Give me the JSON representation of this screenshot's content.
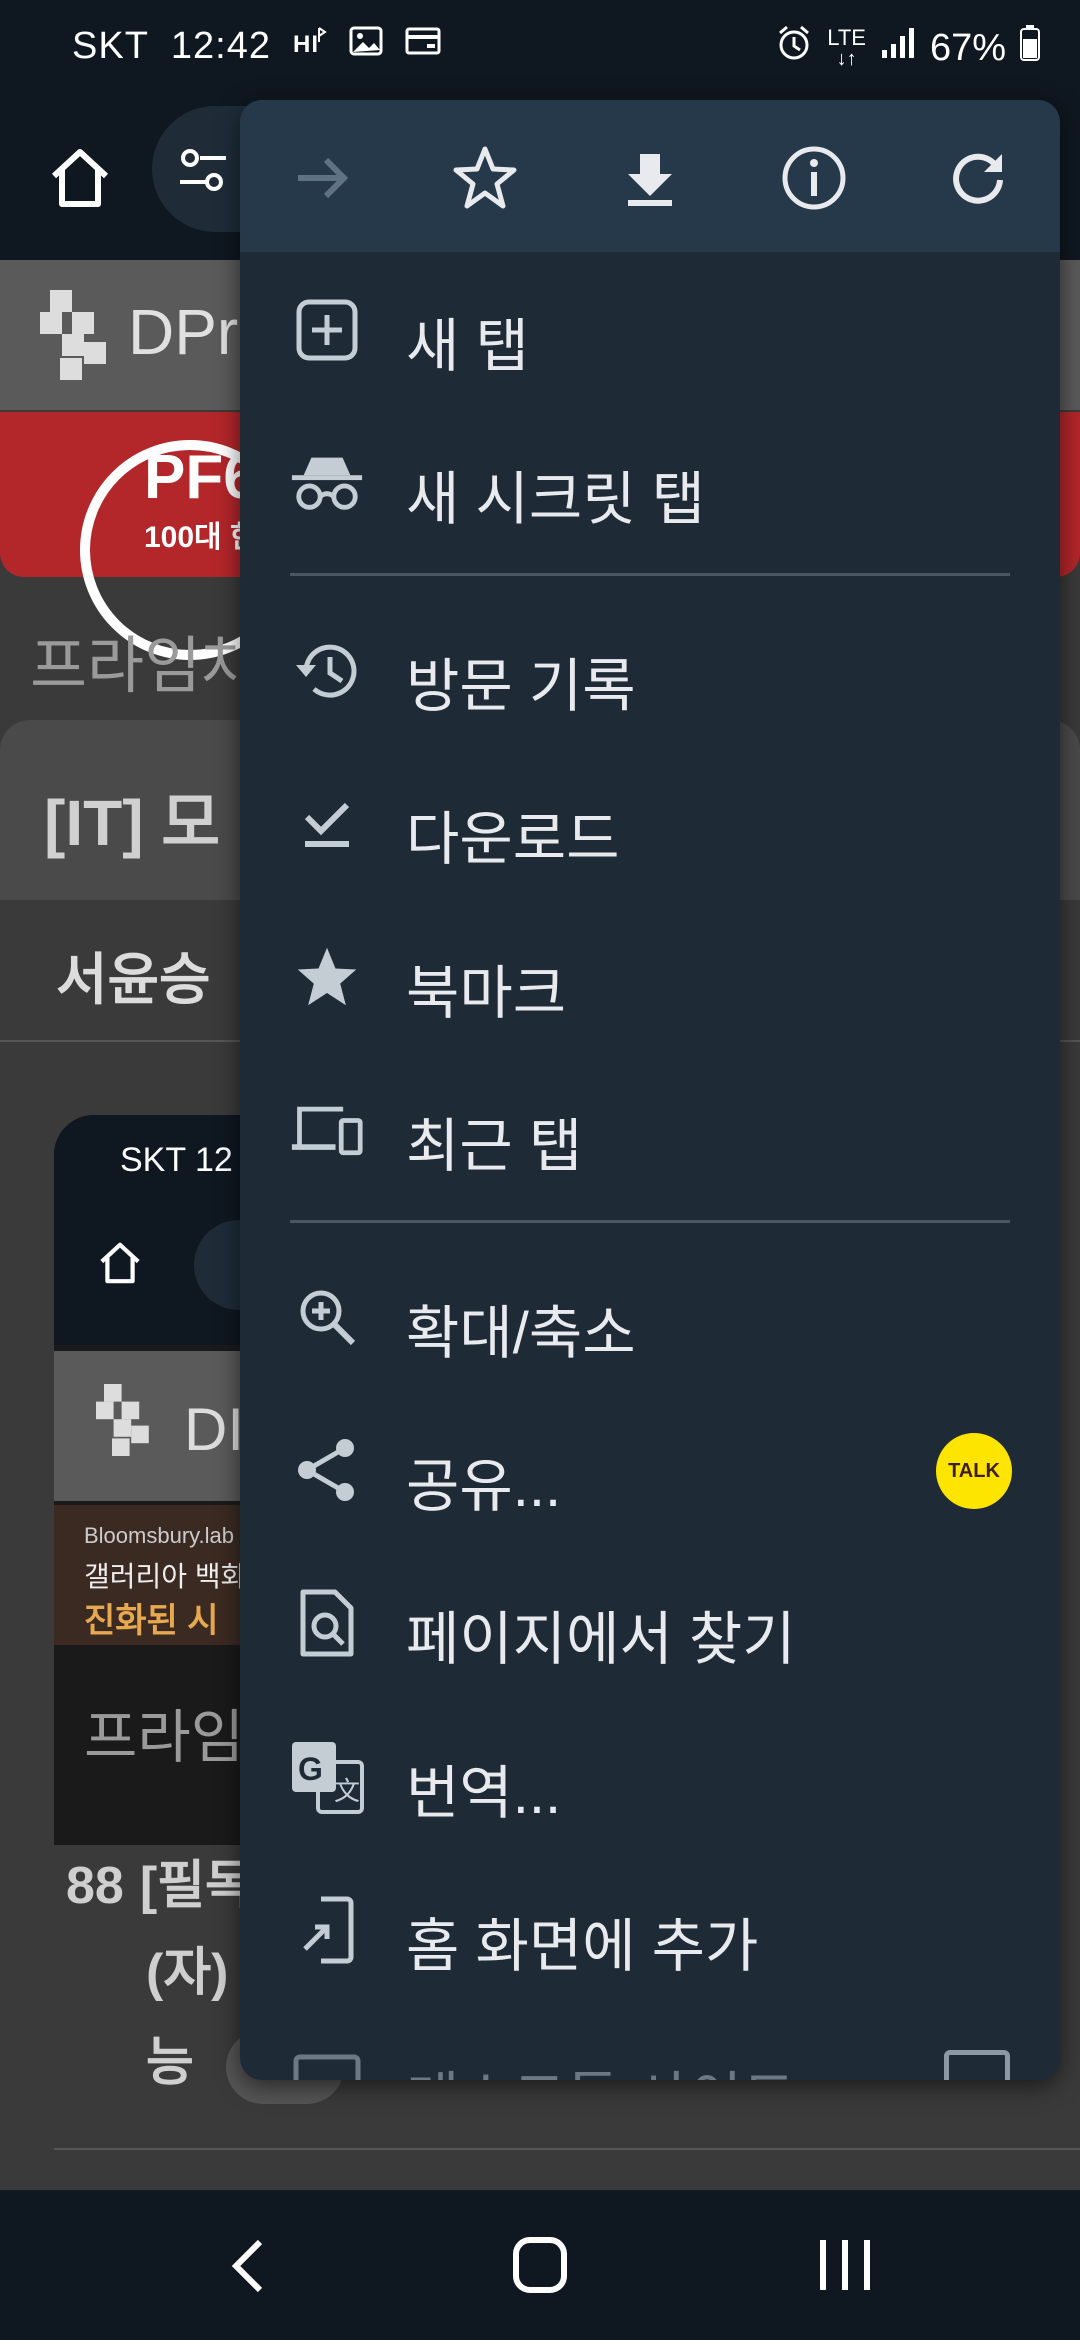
{
  "status_bar": {
    "carrier": "SKT",
    "time": "12:42",
    "network": "LTE",
    "battery": "67%"
  },
  "background_page": {
    "brand": "DPr",
    "ad_text_1": "PF6",
    "ad_text_2": "100대 한",
    "breadcrumb": "프라임차",
    "card_title": "[IT]  모",
    "author": "서윤승",
    "thumb_carrier_time": "SKT  12",
    "thumb_brand": "DI",
    "thumb_ad_1": "Bloomsbury.lab",
    "thumb_ad_2": "갤러리아 백화",
    "thumb_ad_3": "진화된 시",
    "thumb_breadcrumb": "프라임",
    "post_number": "88",
    "post_line_1": "[필독",
    "post_line_2": "(자)",
    "post_line_3": "능"
  },
  "menu": {
    "top_actions": [
      {
        "name": "forward",
        "icon": "arrow-right-icon",
        "enabled": false
      },
      {
        "name": "bookmark",
        "icon": "star-outline-icon",
        "enabled": true
      },
      {
        "name": "download",
        "icon": "download-icon",
        "enabled": true
      },
      {
        "name": "page-info",
        "icon": "info-icon",
        "enabled": true
      },
      {
        "name": "reload",
        "icon": "reload-icon",
        "enabled": true
      }
    ],
    "items": [
      {
        "label": "새 탭",
        "icon": "add-box-icon"
      },
      {
        "label": "새 시크릿 탭",
        "icon": "incognito-icon"
      },
      {
        "label": "방문 기록",
        "icon": "history-icon"
      },
      {
        "label": "다운로드",
        "icon": "download-done-icon"
      },
      {
        "label": "북마크",
        "icon": "star-icon"
      },
      {
        "label": "최근 탭",
        "icon": "devices-icon"
      },
      {
        "label": "확대/축소",
        "icon": "zoom-in-icon"
      },
      {
        "label": "공유...",
        "icon": "share-icon"
      },
      {
        "label": "페이지에서 찾기",
        "icon": "find-in-page-icon"
      },
      {
        "label": "번역...",
        "icon": "translate-icon"
      },
      {
        "label": "홈 화면에 추가",
        "icon": "add-to-home-icon"
      },
      {
        "label": "데스크톱 사이트",
        "icon": "desktop-icon"
      }
    ],
    "share_badge": "TALK"
  },
  "colors": {
    "menu_bg": "#1e2b37",
    "menu_top_bg": "#25394a",
    "talk_badge": "#fee500"
  }
}
